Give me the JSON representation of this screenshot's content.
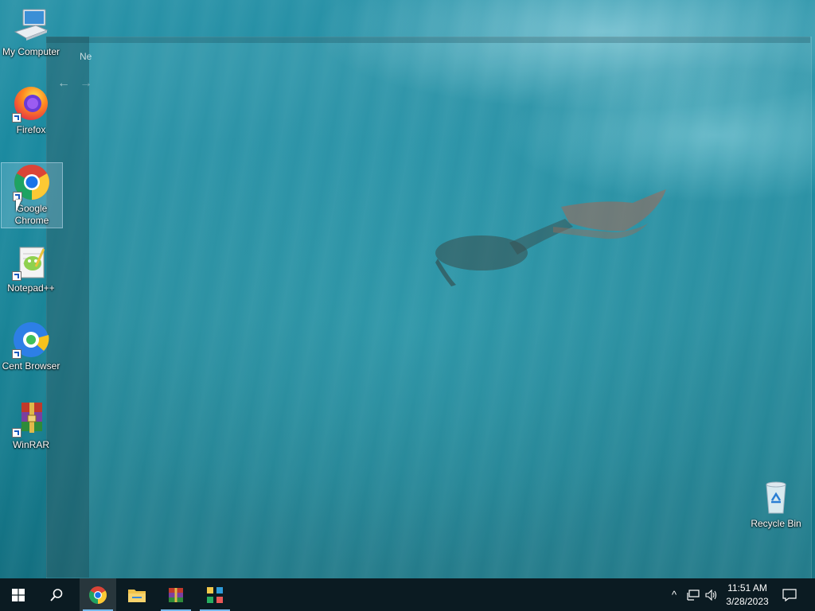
{
  "desktop": {
    "background_description": "",
    "ghost_window": {
      "title_fragment": "Ne",
      "back_glyph": "←",
      "forward_glyph": "→"
    },
    "icons": [
      {
        "label": "My Computer",
        "icon": "computer-icon"
      },
      {
        "label": "Firefox",
        "icon": "firefox-icon"
      },
      {
        "label": "Google Chrome",
        "icon": "chrome-icon"
      },
      {
        "label": "Notepad++",
        "icon": "notepadpp-icon"
      },
      {
        "label": "Cent Browser",
        "icon": "cent-browser-icon"
      },
      {
        "label": "WinRAR",
        "icon": "winrar-icon"
      },
      {
        "label": "Recycle Bin",
        "icon": "recycle-bin-icon"
      }
    ]
  },
  "taskbar": {
    "start_icon": "windows-start-icon",
    "search_icon": "search-icon",
    "apps": [
      {
        "name": "Google Chrome",
        "icon": "chrome-icon",
        "active": true
      },
      {
        "name": "File Explorer",
        "icon": "folder-icon",
        "active": false
      },
      {
        "name": "WinRAR",
        "icon": "winrar-icon",
        "active": false
      },
      {
        "name": "App",
        "icon": "app-grid-icon",
        "active": false
      }
    ],
    "tray": {
      "chevron": "^",
      "network_icon": "network-icon",
      "volume_icon": "volume-icon",
      "time": "11:51 AM",
      "date": "3/28/2023",
      "notifications_icon": "notification-icon"
    }
  },
  "colors": {
    "taskbar": "#0b1b22",
    "accent": "#76b9ed",
    "water": "#1a8598"
  }
}
